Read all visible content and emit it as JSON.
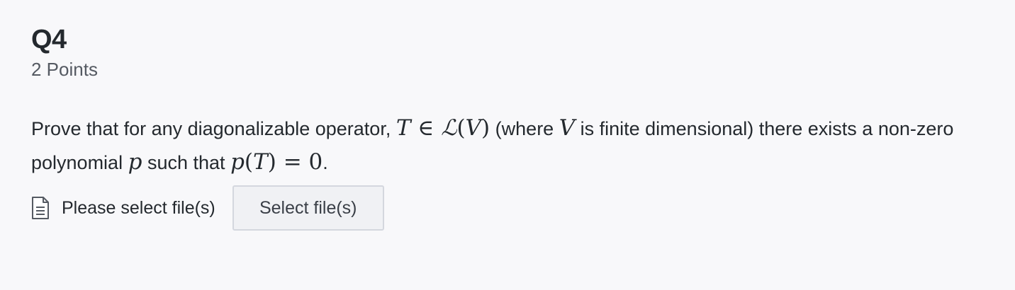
{
  "question": {
    "title": "Q4",
    "points": "2 Points",
    "text": {
      "part1": "Prove that for any diagonalizable operator,",
      "T": "T",
      "in_symbol": "∈",
      "L": "ℒ",
      "open_paren": "(",
      "V": "V",
      "close_paren": ")",
      "part2": "(where",
      "V2": "V",
      "part3": "is finite dimensional) there exists a non-zero polynomial",
      "p": "p",
      "part4": "such that",
      "p2": "p",
      "open_paren2": "(",
      "T2": "T",
      "close_paren2": ")",
      "equals": "=",
      "zero": "0",
      "period": "."
    }
  },
  "upload": {
    "icon": "document-icon",
    "label": "Please select file(s)",
    "button_label": "Select file(s)"
  }
}
